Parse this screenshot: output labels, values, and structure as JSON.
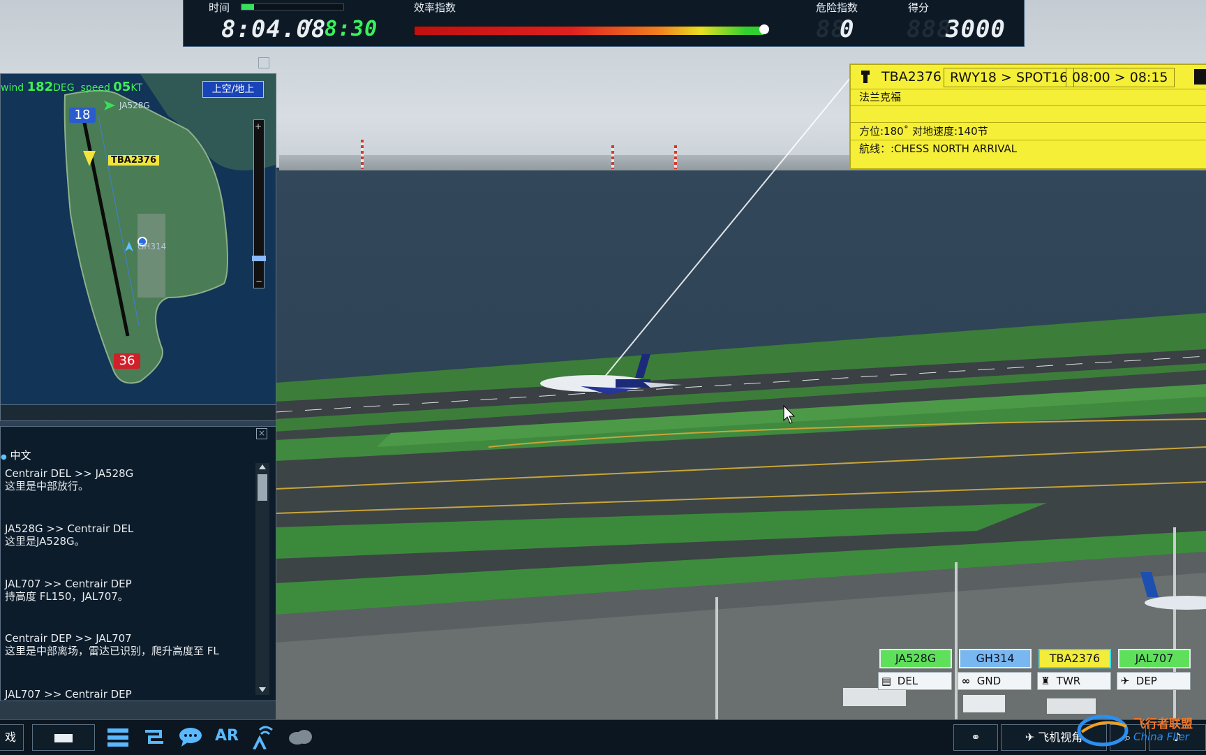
{
  "hud": {
    "time_label": "时间",
    "efficiency_label": "效率指数",
    "danger_label": "危险指数",
    "score_label": "得分",
    "current_time": "8:04.08",
    "separator": "/",
    "end_time": "8:30",
    "time_progress": 0.12,
    "efficiency": 1.0,
    "danger_ghost": "88",
    "danger_value": "0",
    "score_ghost": "888",
    "score_value": "3000"
  },
  "flight_strip": {
    "callsign": "TBA2376",
    "route": "RWY18 > SPOT16",
    "time_window": "08:00 > 08:15",
    "origin": "法兰克福",
    "heading_speed": "方位:180˚ 对地速度:140节",
    "airway": "航线：:CHESS NORTH ARRIVAL"
  },
  "minimap": {
    "wind_prefix": "wind",
    "wind_deg": "182",
    "wind_deg_unit": "DEG",
    "speed_prefix": "speed",
    "speed_value": "05",
    "speed_unit": "KT",
    "mode_toggle": "上空/地上",
    "runway_north": "18",
    "runway_south": "36",
    "labels": {
      "ja528g": "JA528G",
      "tba2376": "TBA2376",
      "gh314": "GH314"
    },
    "zoom_plus": "+",
    "zoom_minus": "−",
    "zoom_level": 0.12
  },
  "log": {
    "language": "中文",
    "messages": [
      {
        "header": "Centrair DEL >> JA528G",
        "body": "这里是中部放行。"
      },
      {
        "header": "JA528G >> Centrair DEL",
        "body": "这里是JA528G。"
      },
      {
        "header": "JAL707 >> Centrair DEP",
        "body": "持高度 FL150，JAL707。"
      },
      {
        "header": "Centrair DEP >> JAL707",
        "body": "这里是中部离场，雷达已识别，爬升高度至 FL"
      },
      {
        "header": "JAL707 >> Centrair DEP",
        "body": ""
      }
    ]
  },
  "aircraft_tags": [
    {
      "label": "JA528G",
      "color": "#5fe05a",
      "role": "DEL",
      "role_icon": "clipboard-icon"
    },
    {
      "label": "GH314",
      "color": "#79b7f0",
      "role": "GND",
      "role_icon": "binoculars-icon"
    },
    {
      "label": "TBA2376",
      "color": "#f2ec3a",
      "role": "TWR",
      "role_icon": "tower-icon"
    },
    {
      "label": "JAL707",
      "color": "#5fe05a",
      "role": "DEP",
      "role_icon": "departure-icon"
    }
  ],
  "toolbar": {
    "left_edge_label": "戏",
    "ar_label": "AR",
    "plane_view_label": "飞机视角"
  },
  "watermark": {
    "line1": "飞行者联盟",
    "line2": "China Flier"
  }
}
